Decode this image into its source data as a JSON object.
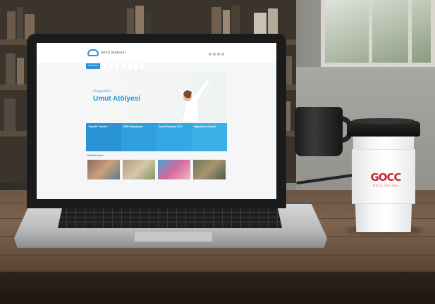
{
  "website": {
    "logo_text": "umut atölyesi",
    "contact": "",
    "nav": [
      {
        "label": "ANASAYFA",
        "active": true
      },
      {
        "label": "",
        "active": false
      },
      {
        "label": "",
        "active": false
      },
      {
        "label": "",
        "active": false
      },
      {
        "label": "",
        "active": false
      },
      {
        "label": "",
        "active": false
      },
      {
        "label": "",
        "active": false
      },
      {
        "label": "",
        "active": false
      }
    ],
    "hero": {
      "subtitle": "Hoşgeldiniz",
      "title": "Umut Atölyesi"
    },
    "panels": [
      {
        "title": "\"Umutla\" Yarınlar",
        "text": "",
        "more": "",
        "color": "#2a93d5"
      },
      {
        "title": "SMA Kampanyası",
        "text": "",
        "more": "",
        "color": "#2fa0dc"
      },
      {
        "title": "Gezim Programı 2017",
        "text": "",
        "more": "",
        "color": "#34a8e2"
      },
      {
        "title": "Bağışlarınız Önemli",
        "text": "",
        "more": "",
        "color": "#3bb1e8"
      }
    ],
    "section_title": "Etkinliklerimiz",
    "thumbs": [
      {
        "label": "",
        "color": "#8a6b5a"
      },
      {
        "label": "",
        "color": "#b09a85"
      },
      {
        "label": "",
        "color": "#d46a9a"
      },
      {
        "label": "",
        "color": "#6a7a5c"
      }
    ]
  },
  "cup": {
    "brand": "GOCC",
    "tagline": "GOCC DESIGN",
    "brand_color": "#c8242b"
  },
  "colors": {
    "accent": "#2a93d5"
  }
}
